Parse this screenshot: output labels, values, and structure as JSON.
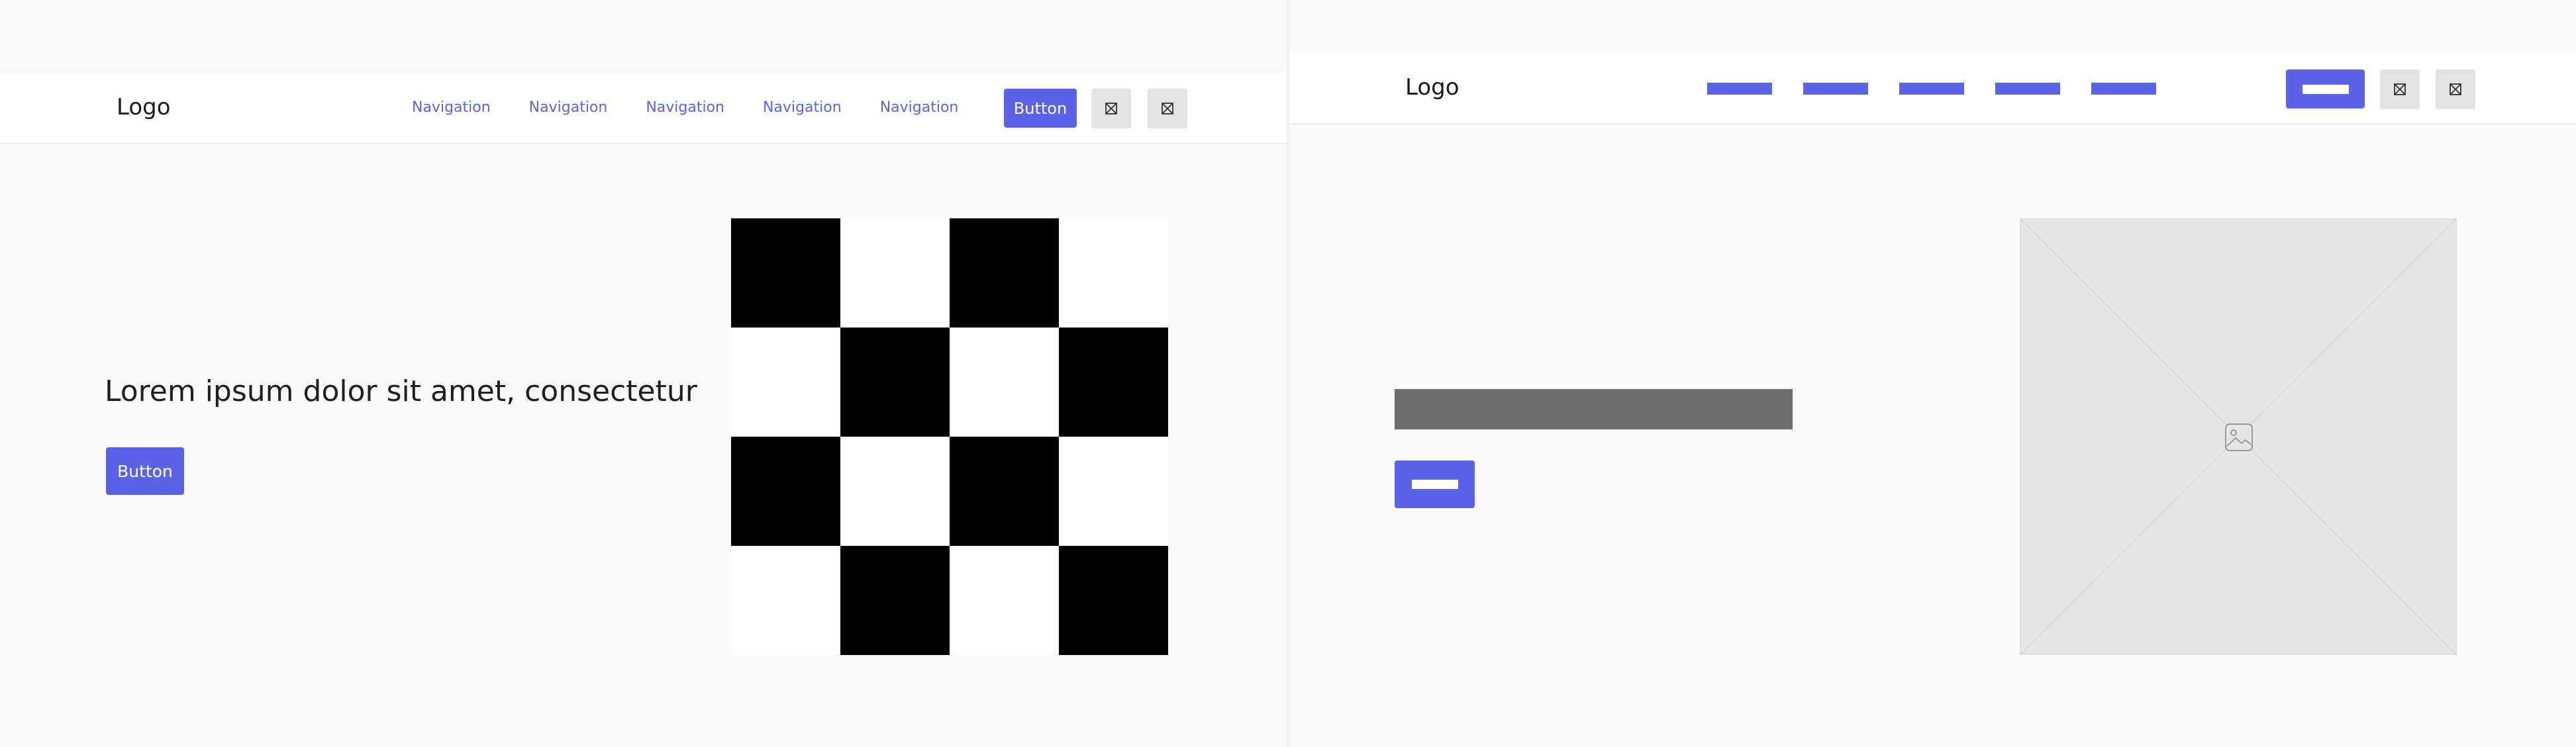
{
  "left_panel": {
    "header": {
      "logo": "Logo",
      "nav": [
        "Navigation",
        "Navigation",
        "Navigation",
        "Navigation",
        "Navigation"
      ],
      "button_label": "Button",
      "icon_buttons": [
        "close-box-icon",
        "close-box-icon"
      ]
    },
    "hero": {
      "headline": "Lorem ipsum dolor sit amet, consectetur",
      "button_label": "Button",
      "image": "checkerboard-image"
    }
  },
  "right_panel": {
    "header": {
      "logo": "Logo",
      "nav_placeholder_count": 5,
      "icon_buttons": [
        "close-box-icon",
        "close-box-icon"
      ]
    },
    "hero": {
      "image": "image-placeholder-icon"
    }
  },
  "colors": {
    "accent": "#5a63e6",
    "background": "#f9f9f9",
    "header": "#ffffff",
    "placeholder_text": "#6f6d70",
    "icon_button": "#e3e3e3"
  }
}
